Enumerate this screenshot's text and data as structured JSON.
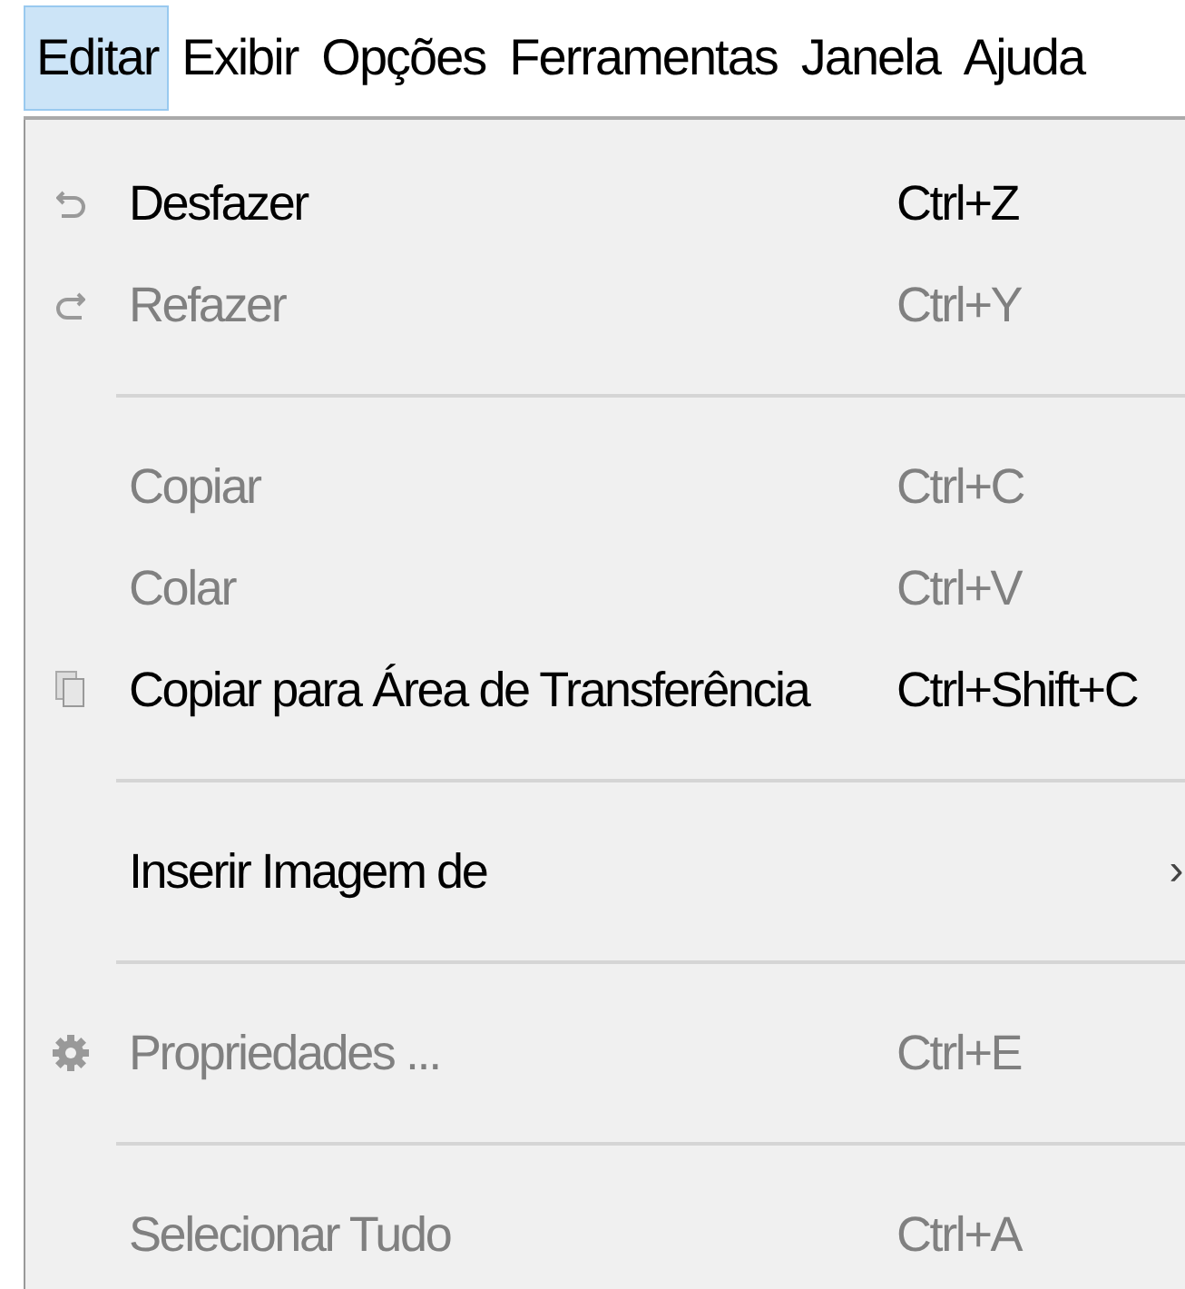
{
  "menu_bar": [
    {
      "label": "Editar",
      "selected": true
    },
    {
      "label": "Exibir",
      "selected": false
    },
    {
      "label": "Opções",
      "selected": false
    },
    {
      "label": "Ferramentas",
      "selected": false
    },
    {
      "label": "Janela",
      "selected": false
    },
    {
      "label": "Ajuda",
      "selected": false
    }
  ],
  "menu": [
    {
      "kind": "item",
      "label": "Desfazer",
      "shortcut": "Ctrl+Z",
      "disabled": false
    },
    {
      "kind": "item",
      "label": "Refazer",
      "shortcut": "Ctrl+Y",
      "disabled": true
    },
    {
      "kind": "separator"
    },
    {
      "kind": "item",
      "label": "Copiar",
      "shortcut": "Ctrl+C",
      "disabled": true
    },
    {
      "kind": "item",
      "label": "Colar",
      "shortcut": "Ctrl+V",
      "disabled": true
    },
    {
      "kind": "item",
      "label": "Copiar para Área de Transferência",
      "shortcut": "Ctrl+Shift+C",
      "disabled": false
    },
    {
      "kind": "separator"
    },
    {
      "kind": "submenu",
      "label": "Inserir Imagem de",
      "arrow": "›",
      "disabled": false
    },
    {
      "kind": "separator"
    },
    {
      "kind": "item",
      "label": "Propriedades ...",
      "shortcut": "Ctrl+E",
      "disabled": true
    },
    {
      "kind": "separator"
    },
    {
      "kind": "item",
      "label": "Selecionar Tudo",
      "shortcut": "Ctrl+A",
      "disabled": true
    }
  ]
}
